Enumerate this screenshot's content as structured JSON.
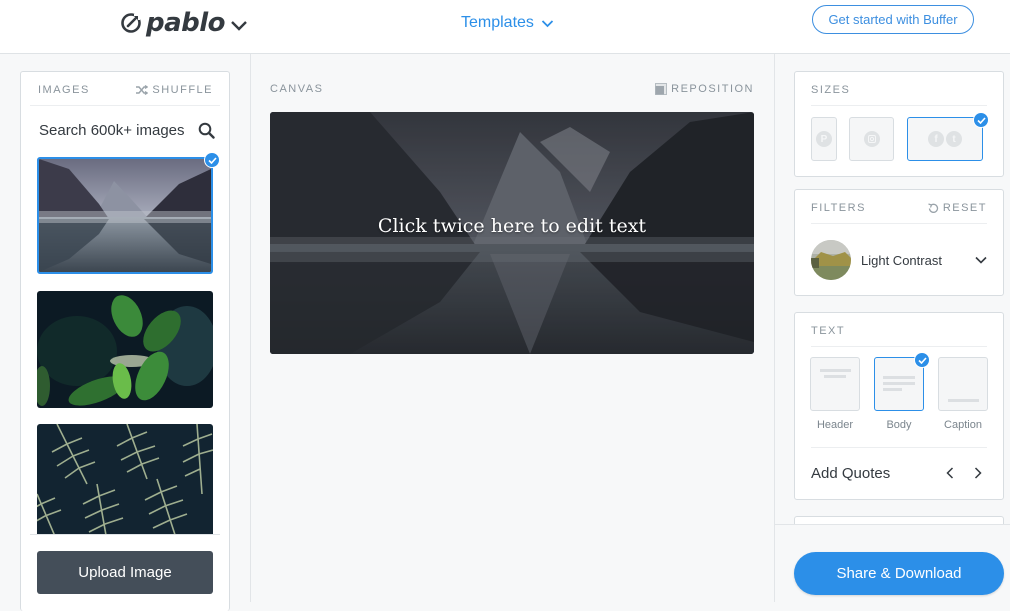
{
  "header": {
    "logo_text": "pablo",
    "templates_label": "Templates",
    "cta_label": "Get started with Buffer"
  },
  "images": {
    "section_label": "IMAGES",
    "shuffle_label": "SHUFFLE",
    "search_placeholder": "Search 600k+ images",
    "thumbnails": [
      {
        "subject": "misty mountain lake",
        "selected": true
      },
      {
        "subject": "green leaves with buds",
        "selected": false
      },
      {
        "subject": "fern fronds",
        "selected": false
      }
    ],
    "upload_label": "Upload Image"
  },
  "canvas": {
    "section_label": "CANVAS",
    "reposition_label": "REPOSITION",
    "text": "Click twice here to edit text"
  },
  "sizes": {
    "section_label": "SIZES",
    "options": [
      {
        "name": "pinterest",
        "icons": [
          "pinterest-icon"
        ],
        "selected": false
      },
      {
        "name": "instagram",
        "icons": [
          "instagram-icon"
        ],
        "selected": false
      },
      {
        "name": "facebook-twitter",
        "icons": [
          "facebook-icon",
          "twitter-icon"
        ],
        "selected": true
      }
    ]
  },
  "filters": {
    "section_label": "FILTERS",
    "reset_label": "RESET",
    "selected_filter": "Light Contrast"
  },
  "text": {
    "section_label": "TEXT",
    "options": [
      {
        "label": "Header",
        "selected": false
      },
      {
        "label": "Body",
        "selected": true
      },
      {
        "label": "Caption",
        "selected": false
      }
    ],
    "quotes_label": "Add Quotes"
  },
  "footer": {
    "share_label": "Share & Download"
  },
  "colors": {
    "accent": "#2c8fe8",
    "upload_button": "#444e59",
    "text_dark": "#343a40",
    "label_gray": "#8a949c"
  }
}
